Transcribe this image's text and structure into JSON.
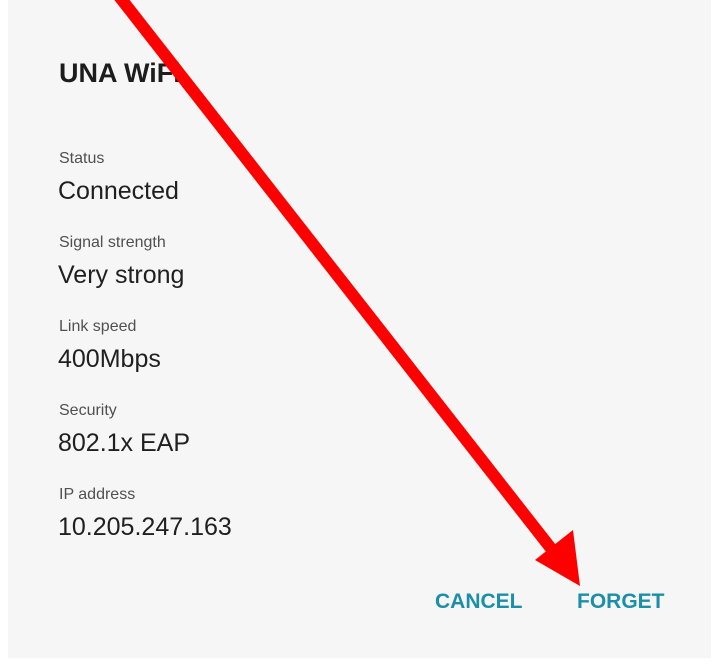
{
  "dialog": {
    "title": "UNA WiFi",
    "fields": [
      {
        "label": "Status",
        "value": "Connected"
      },
      {
        "label": "Signal strength",
        "value": "Very strong"
      },
      {
        "label": "Link speed",
        "value": "400Mbps"
      },
      {
        "label": "Security",
        "value": "802.1x EAP"
      },
      {
        "label": "IP address",
        "value": "10.205.247.163"
      }
    ],
    "buttons": {
      "cancel_label": "CANCEL",
      "forget_label": "FORGET"
    },
    "accent_color": "#1c8fa8"
  },
  "annotation": {
    "icon": "red-arrow-icon",
    "color": "#ff0000"
  }
}
